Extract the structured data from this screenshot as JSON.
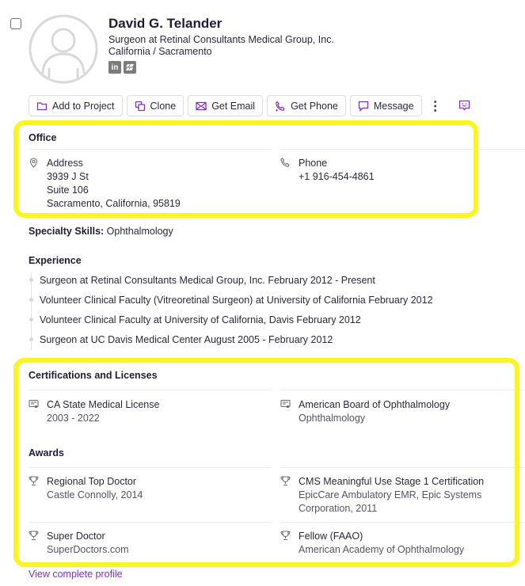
{
  "profile": {
    "name": "David G. Telander",
    "title": "Surgeon at Retinal Consultants Medical Group, Inc.",
    "location": "California / Sacramento",
    "socials": [
      {
        "icon": "linkedin-icon",
        "label": "in"
      },
      {
        "icon": "website-icon",
        "label": "▰"
      }
    ]
  },
  "actions": {
    "add_to_project": "Add to Project",
    "clone": "Clone",
    "get_email": "Get Email",
    "get_phone": "Get Phone",
    "message": "Message",
    "more": "⋮"
  },
  "office": {
    "title": "Office",
    "address": {
      "label": "Address",
      "line1": "3939 J St",
      "line2": "Suite 106",
      "line3": "Sacramento, California, 95819"
    },
    "phone": {
      "label": "Phone",
      "value": "+1 916-454-4861"
    }
  },
  "specialty": {
    "label": "Specialty Skills:",
    "value": "Ophthalmology"
  },
  "experience": {
    "title": "Experience",
    "items": [
      "Surgeon at Retinal Consultants Medical Group, Inc. February 2012 - Present",
      "Volunteer Clinical Faculty (Vitreoretinal Surgeon) at University of California February 2012",
      "Volunteer Clinical Faculty at University of California, Davis February 2012",
      "Surgeon at UC Davis Medical Center August 2005 - February 2012"
    ]
  },
  "certifications": {
    "title": "Certifications and Licenses",
    "items": [
      {
        "name": "CA State Medical License",
        "detail": "2003 - 2022"
      },
      {
        "name": "American Board of Ophthalmology",
        "detail": "Ophthalmology"
      }
    ]
  },
  "awards": {
    "title": "Awards",
    "items": [
      {
        "name": "Regional Top Doctor",
        "detail": "Castle Connolly, 2014"
      },
      {
        "name": "CMS Meaningful Use Stage 1 Certification",
        "detail": "EpicCare Ambulatory EMR, Epic Systems",
        "detail2": "Corporation, 2011"
      },
      {
        "name": "Super Doctor",
        "detail": "SuperDoctors.com"
      },
      {
        "name": "Fellow (FAAO)",
        "detail": "American Academy of Ophthalmology"
      }
    ]
  },
  "footer": {
    "view_profile": "View complete profile"
  },
  "colors": {
    "accent": "#7e2fbf",
    "highlight": "#fbf51f"
  }
}
